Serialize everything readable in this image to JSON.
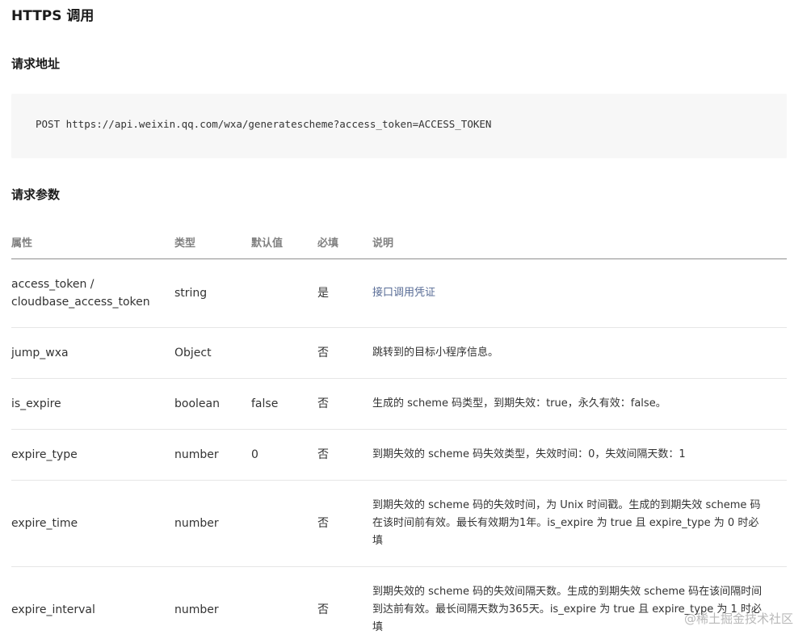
{
  "page": {
    "title": "HTTPS 调用"
  },
  "sections": {
    "request_url_title": "请求地址",
    "request_params_title": "请求参数"
  },
  "request": {
    "url_line": "POST https://api.weixin.qq.com/wxa/generatescheme?access_token=ACCESS_TOKEN"
  },
  "table": {
    "headers": [
      "属性",
      "类型",
      "默认值",
      "必填",
      "说明"
    ],
    "rows": [
      {
        "name_line1": "access_token /",
        "name_line2": "cloudbase_access_token",
        "type": "string",
        "default": "",
        "required": "是",
        "desc": "接口调用凭证"
      },
      {
        "name": "jump_wxa",
        "type": "Object",
        "default": "",
        "required": "否",
        "desc": "跳转到的目标小程序信息。"
      },
      {
        "name": "is_expire",
        "type": "boolean",
        "default": "false",
        "required": "否",
        "desc": "生成的 scheme 码类型，到期失效：true，永久有效：false。"
      },
      {
        "name": "expire_type",
        "type": "number",
        "default": "0",
        "required": "否",
        "desc": "到期失效的 scheme 码失效类型，失效时间：0，失效间隔天数：1"
      },
      {
        "name": "expire_time",
        "type": "number",
        "default": "",
        "required": "否",
        "desc_line1": "到期失效的 scheme 码的失效时间，为 Unix 时间戳。生成的到期失效 scheme 码",
        "desc_line2": "在该时间前有效。最长有效期为1年。is_expire 为 true 且 expire_type 为 0 时必",
        "desc_line3": "填"
      },
      {
        "name": "expire_interval",
        "type": "number",
        "default": "",
        "required": "否",
        "desc_line1": "到期失效的 scheme 码的失效间隔天数。生成的到期失效 scheme 码在该间隔时间",
        "desc_line2": "到达前有效。最长间隔天数为365天。is_expire 为 true 且 expire_type 为 1 时必",
        "desc_line3": "填"
      }
    ]
  },
  "watermark": "@稀土掘金技术社区",
  "colors": {
    "link": "#576b95",
    "code_bg": "#f7f7f7",
    "header_text": "#808080"
  }
}
